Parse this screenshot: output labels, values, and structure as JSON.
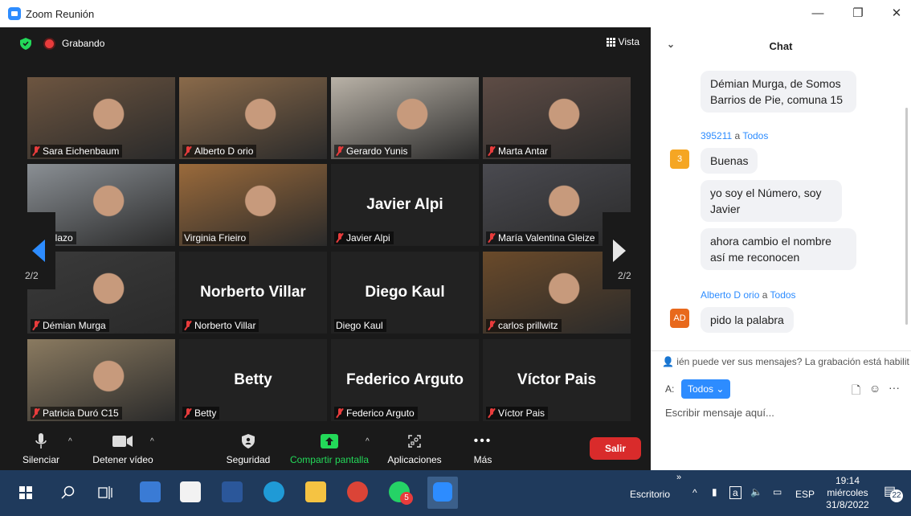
{
  "window": {
    "title": "Zoom Reunión",
    "minimize": "—",
    "restore": "❐",
    "close": "✕"
  },
  "topbar": {
    "recording": "Grabando",
    "view": "Vista"
  },
  "pages": {
    "left": "2/2",
    "right": "2/2"
  },
  "participants": [
    {
      "name": "Sara Eichenbaum",
      "muted": true,
      "video": true,
      "bg": "#6d5540"
    },
    {
      "name": "Alberto D orio",
      "muted": true,
      "video": true,
      "bg": "#8a6a4a"
    },
    {
      "name": "Gerardo Yunis",
      "muted": true,
      "video": true,
      "bg": "#b9b2a7"
    },
    {
      "name": "Marta Antar",
      "muted": true,
      "video": true,
      "bg": "#5e4c45"
    },
    {
      "name": "Garcilazo",
      "muted": false,
      "video": true,
      "bg": "#8a8f94"
    },
    {
      "name": "Virginia Frieiro",
      "muted": false,
      "video": true,
      "bg": "#9a6a3b"
    },
    {
      "name": "Javier Alpi",
      "muted": true,
      "video": false,
      "bg": "#222"
    },
    {
      "name": "María Valentina Gleize",
      "muted": true,
      "video": true,
      "bg": "#4a4a50"
    },
    {
      "name": "Démian Murga",
      "muted": true,
      "video": true,
      "bg": "#3a3a3a"
    },
    {
      "name": "Norberto Villar",
      "muted": true,
      "video": false,
      "bg": "#222"
    },
    {
      "name": "Diego Kaul",
      "muted": false,
      "video": false,
      "bg": "#222"
    },
    {
      "name": "carlos prillwitz",
      "muted": true,
      "video": true,
      "bg": "#6a4a2a"
    },
    {
      "name": "Patricia Duró C15",
      "muted": true,
      "video": true,
      "bg": "#8a7a60"
    },
    {
      "name": "Betty",
      "muted": true,
      "video": false,
      "bg": "#222"
    },
    {
      "name": "Federico Arguto",
      "muted": true,
      "video": false,
      "bg": "#222"
    },
    {
      "name": "Víctor Pais",
      "muted": true,
      "video": false,
      "bg": "#222"
    }
  ],
  "toolbar": {
    "mute": "Silenciar",
    "video": "Detener vídeo",
    "security": "Seguridad",
    "share": "Compartir pantalla",
    "apps": "Aplicaciones",
    "more": "Más",
    "leave": "Salir"
  },
  "chat": {
    "title": "Chat",
    "messages": [
      {
        "text": "Démian Murga, de Somos Barrios de Pie, comuna 15"
      },
      {
        "sender": "395211",
        "to": "Todos",
        "avatar": "3",
        "avatar_color": "#f5a623",
        "text": "Buenas"
      },
      {
        "text": "yo soy el Número, soy Javier"
      },
      {
        "text": "ahora cambio el nombre así me reconocen"
      },
      {
        "sender": "Alberto D orio",
        "to": "Todos",
        "avatar": "AD",
        "avatar_color": "#e8691c",
        "text": "pido la palabra"
      }
    ],
    "to_word": "a",
    "notice": "ién puede ver sus mensajes? La grabación está habilit",
    "recipient_label": "A:",
    "recipient": "Todos",
    "placeholder": "Escribir mensaje aquí..."
  },
  "taskbar": {
    "desktop": "Escritorio",
    "lang": "ESP",
    "time": "19:14",
    "day": "miércoles",
    "date": "31/8/2022",
    "whatsapp_badge": "5",
    "notifications": "22"
  }
}
